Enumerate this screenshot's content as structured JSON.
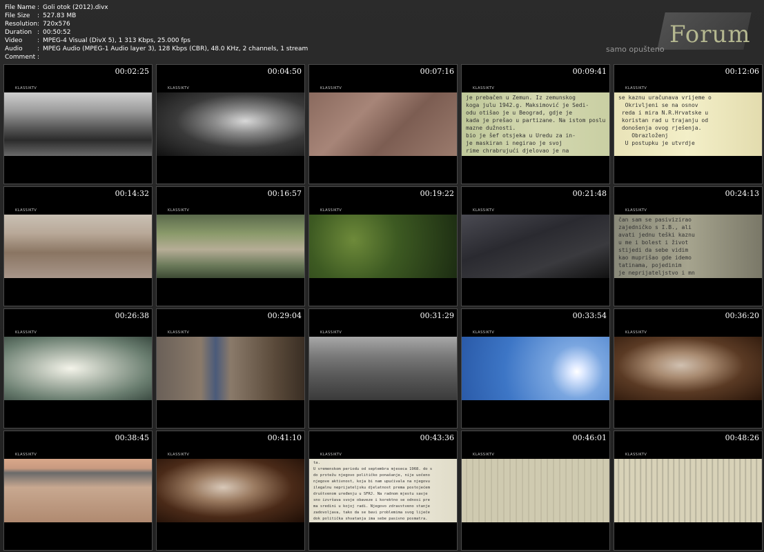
{
  "meta": [
    {
      "label": "File Name",
      "value": "Goli otok (2012).divx"
    },
    {
      "label": "File Size",
      "value": "527.83 MB"
    },
    {
      "label": "Resolution",
      "value": "720x576"
    },
    {
      "label": "Duration",
      "value": "00:50:52"
    },
    {
      "label": "Video",
      "value": "MPEG-4 Visual (DivX 5), 1 313 Kbps, 25.000 fps"
    },
    {
      "label": "Audio",
      "value": "MPEG Audio (MPEG-1 Audio layer 3), 128 Kbps (CBR), 48.0 KHz, 2 channels, 1 stream"
    },
    {
      "label": "Comment",
      "value": ""
    }
  ],
  "separator": ":",
  "logo": {
    "name": "Forum",
    "tagline": "samo opušteno"
  },
  "watermark": "KLASSIKTV",
  "thumbnails": [
    {
      "time": "00:02:25",
      "scene": "bw-crowd-train"
    },
    {
      "time": "00:04:50",
      "scene": "bw-speaker-mics"
    },
    {
      "time": "00:07:16",
      "scene": "ground-texture"
    },
    {
      "time": "00:09:41",
      "scene": "typed-document",
      "text": "je prebačen u Zemun. Iz zemunskog\nkoga julu 1942.g. Maksimović je Sedi-\nodu otišao je u Beograd, gdje je\nkada je prešao u partizane. Na istom poslu\nmazne dužnosti.\nbio je šef otsjeka u Uredu za in-\nje maskiran i negirao je svoj\nrime chrabrujući djelovao je na\nlovati na liniji IB-a."
    },
    {
      "time": "00:12:06",
      "scene": "typed-document-zoom",
      "text": "se kaznu uračunava vrijeme o\n  Okrivljeni se na osnov\n reda i mira N.R.Hrvatske u\n koristan rad u trajanju od\n donošenja ovog rješenja.\n    Obrazloženj\n  U postupku je utvrdje"
    },
    {
      "time": "00:14:32",
      "scene": "rocks"
    },
    {
      "time": "00:16:57",
      "scene": "camp-landscape"
    },
    {
      "time": "00:19:22",
      "scene": "plants-rock"
    },
    {
      "time": "00:21:48",
      "scene": "dark-interior"
    },
    {
      "time": "00:24:13",
      "scene": "typed-document-dark",
      "text": "čan sam se pasivizirao\nzajedničko s I.B., ali\navati jednu teški kaznu\nu me i bolest i život\nstijedi da sebe vidim\nkao muprišao gde idemo\ntatinama, pojedinim\nje neprijateljstvo i mn"
    },
    {
      "time": "00:26:38",
      "scene": "handwriting-glow"
    },
    {
      "time": "00:29:04",
      "scene": "stone-wall-building"
    },
    {
      "time": "00:31:29",
      "scene": "bw-parade"
    },
    {
      "time": "00:33:54",
      "scene": "sun-sky"
    },
    {
      "time": "00:36:20",
      "scene": "old-man-interview"
    },
    {
      "time": "00:38:45",
      "scene": "beach-walker"
    },
    {
      "time": "00:41:10",
      "scene": "old-man-interview-2"
    },
    {
      "time": "00:43:36",
      "scene": "typed-report",
      "text": "ta.\nU vremenskom periodu od septembra mjeseca 1968. do s\ndo protežu njegovo političko ponašanje, nije uočeno\nnjegove aktivnost, koja bi nam upućivala na njegovu\nilegalnu neprijateljsku djelatnost prema postojećem\ndruštvenom uređenju u SFRJ. Na radnom mjestu savje\nsno izvršava svoje obaveze i korektno se odnosi pre\nma sredini u kojoj radi. Njegovo zdravstveno stanje\nzadovoljava, tako da se bavi problemima svog liječe\ndok politička shvatanja ima sebe pasivno posmatra."
    },
    {
      "time": "00:46:01",
      "scene": "ledger"
    },
    {
      "time": "00:48:26",
      "scene": "ledger-2"
    }
  ]
}
